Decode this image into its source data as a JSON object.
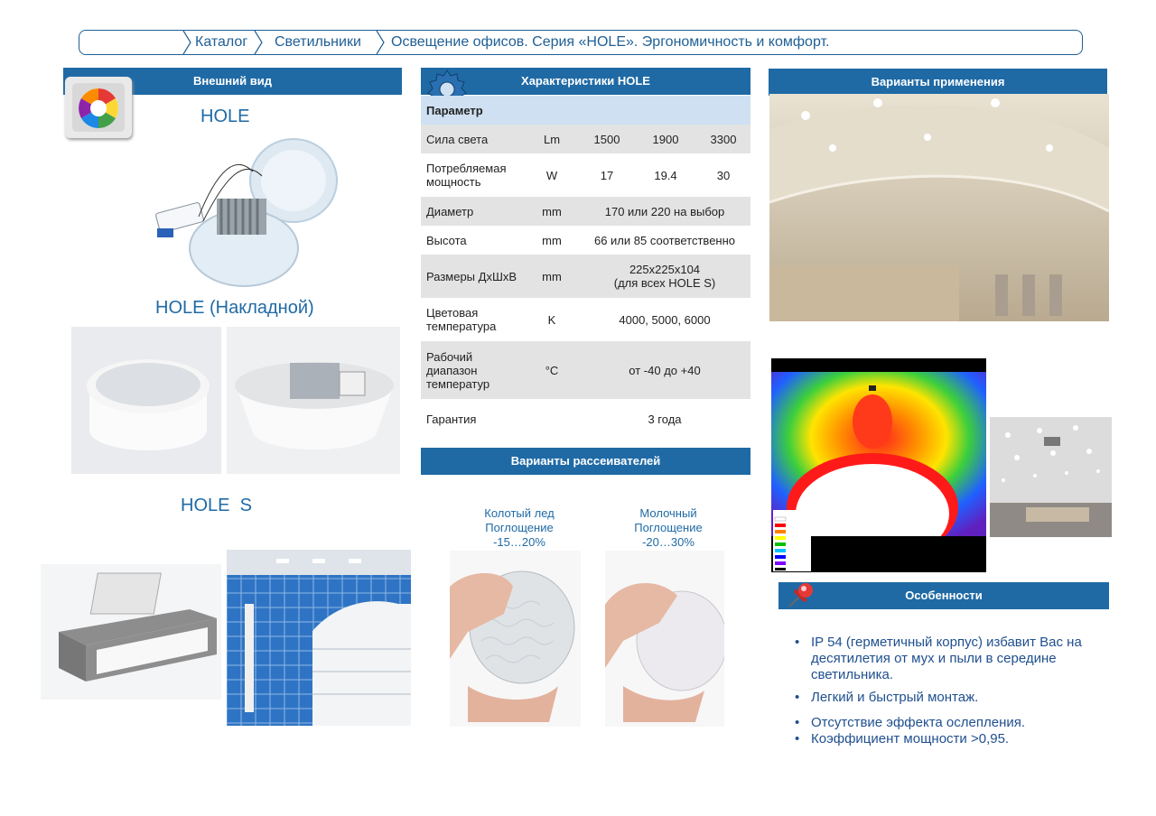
{
  "breadcrumb": {
    "items": [
      "Каталог",
      "Светильники",
      "Освещение офисов. Серия «HOLE». Эргономичность и комфорт."
    ]
  },
  "left": {
    "header": "Внешний вид",
    "title_hole": "HOLE",
    "title_nakladnoy": "HOLE (Накладной)",
    "title_hole_s": "HOLE  S"
  },
  "specs": {
    "header": "Характеристики HOLE",
    "param_header": "Параметр",
    "rows": [
      {
        "name": "Сила света",
        "unit": "Lm",
        "v1": "1500",
        "v2": "1900",
        "v3": "3300"
      },
      {
        "name": "Потребляемая мощность",
        "unit": "W",
        "v1": "17",
        "v2": "19.4",
        "v3": "30"
      },
      {
        "name": "Диаметр",
        "unit": "mm",
        "span": "170 или 220 на выбор"
      },
      {
        "name": "Высота",
        "unit": "mm",
        "span": "66 или 85 соответственно"
      },
      {
        "name": "Размеры ДхШхВ",
        "unit": "mm",
        "span": "225x225x104\n(для всех HOLE S)"
      },
      {
        "name": "Цветовая температура",
        "unit": "K",
        "span": "4000, 5000, 6000"
      },
      {
        "name": "Рабочий диапазон температур",
        "unit": "°C",
        "span": "от -40 до +40"
      },
      {
        "name": "Гарантия",
        "unit": "",
        "span": "3 года"
      }
    ]
  },
  "diffusers": {
    "header": "Варианты рассеивателей",
    "ice": {
      "l1": "Колотый лед",
      "l2": "Поглощение",
      "l3": "-15…20%"
    },
    "milk": {
      "l1": "Молочный",
      "l2": "Поглощение",
      "l3": "-20…30%"
    }
  },
  "applications": {
    "header": "Варианты применения"
  },
  "features": {
    "header": "Особенности",
    "items": [
      "IP 54 (герметичный корпус) избавит Вас на десятилетия от мух и пыли в середине светильника.",
      "Легкий и быстрый монтаж.",
      "Отсутствие эффекта ослепления.",
      "Коэффициент мощности >0,95."
    ]
  },
  "colors": {
    "accent": "#1f6aa5",
    "table_alt": "#e3e3e3",
    "table_head": "#cfe0f2"
  }
}
